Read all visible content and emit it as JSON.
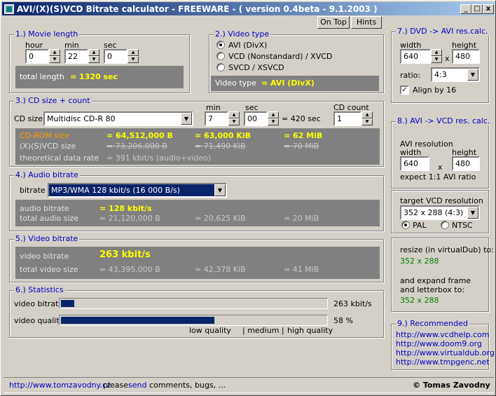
{
  "window": {
    "title": "AVI/(X)(S)VCD Bitrate calculator  - FREEWARE -  ( version 0.4beta - 9.1.2003 )",
    "buttons": {
      "minimize": "_",
      "maximize": "□",
      "close": "x"
    }
  },
  "toolbar": {
    "ontop_label": "On Top",
    "hints_label": "Hints"
  },
  "movie_length": {
    "title": "1.) Movie length",
    "hour_label": "hour",
    "hour_value": "0",
    "min_label": "min",
    "min_value": "22",
    "sec_label": "sec",
    "sec_value": "0",
    "total_label": "total length",
    "total_value": "= 1320 sec"
  },
  "video_type": {
    "title": "2.) Video type",
    "options": [
      "AVI (DivX)",
      "VCD (Nonstandard) / XVCD",
      "SVCD / XSVCD"
    ],
    "selected_index": 0,
    "result_label": "Video type",
    "result_value": "= AVI (DivX)"
  },
  "cd_size": {
    "title": "3.) CD size + count",
    "size_label": "CD size",
    "size_value": "Multidisc CD-R 80",
    "min_label": "min",
    "min_value": "7",
    "sec_label": "sec",
    "sec_value": "00",
    "equals": "= 420 sec",
    "count_label": "CD count",
    "count_value": "1",
    "rows": [
      {
        "label": "CD-ROM size",
        "v1": "= 64,512,000 B",
        "v2": "= 63,000 KiB",
        "v3": "= 62 MiB"
      },
      {
        "label": "(X)(S)VCD size",
        "v1": "= 73,206,000 B",
        "v2": "= 71,490 KiB",
        "v3": "= 70 MiB"
      }
    ],
    "rate_label": "theoretical data rate",
    "rate_value": "= 391 kbit/s (audio+video)"
  },
  "audio": {
    "title": "4.) Audio bitrate",
    "bitrate_label": "bitrate",
    "bitrate_value": "MP3/WMA 128 kbit/s (16 000 B/s)",
    "row1_label": "audio bitrate",
    "row1_value": "= 128 kbit/s",
    "row2_label": "total audio size",
    "row2_v1": "= 21,120,000 B",
    "row2_v2": "= 20,625 KiB",
    "row2_v3": "= 20 MiB"
  },
  "video": {
    "title": "5.) Video bitrate",
    "row1_label": "video bitrate",
    "row1_value": "263 kbit/s",
    "row2_label": "total video size",
    "row2_v1": "= 43,395,000 B",
    "row2_v2": "= 42,378 KiB",
    "row2_v3": "= 41 MiB"
  },
  "statistics": {
    "title": "6.) Statistics",
    "bitrate_label": "video bitrate",
    "bitrate_value": "263 kbit/s",
    "bitrate_fraction": 0.05,
    "quality_label": "video quality",
    "quality_value": "58 %",
    "quality_fraction": 0.58,
    "scale_low": "low quality",
    "scale_medium": "| medium |",
    "scale_high": "high quality"
  },
  "dvd_avi": {
    "title": "7.) DVD -> AVI res.calc.",
    "width_label": "width",
    "width_value": "640",
    "x_label": "x",
    "height_label": "height",
    "height_value": "480",
    "ratio_label": "ratio:",
    "ratio_value": "4:3",
    "align_label": "Align by 16",
    "align_checked": true
  },
  "avi_vcd": {
    "title": "8.) AVI -> VCD res. calc.",
    "res_label": "AVI resolution",
    "width_label": "width",
    "width_value": "640",
    "x_label": "x",
    "height_label": "height",
    "height_value": "480",
    "expect": "expect 1:1 AVI ratio",
    "target_label": "target VCD resolution",
    "target_value": "352 x 288 (4:3)",
    "pal_label": "PAL",
    "ntsc_label": "NTSC",
    "resize_label": "resize (in virtualDub) to:",
    "resize_value": "352 x 288",
    "expand_label1": "and expand frame",
    "expand_label2": "and letterbox to:",
    "expand_value": "352 x 288"
  },
  "recommended": {
    "title": "9.) Recommended",
    "links": [
      "http://www.vcdhelp.com",
      "http://www.doom9.org",
      "http://www.virtualdub.org",
      "http://www.tmpgenc.net"
    ]
  },
  "status": {
    "url": "http://www.tomzavodny.cz",
    "please": "please",
    "send": "send",
    "rest": "comments, bugs, ...",
    "copyright": "© Tomas Zavodny"
  }
}
